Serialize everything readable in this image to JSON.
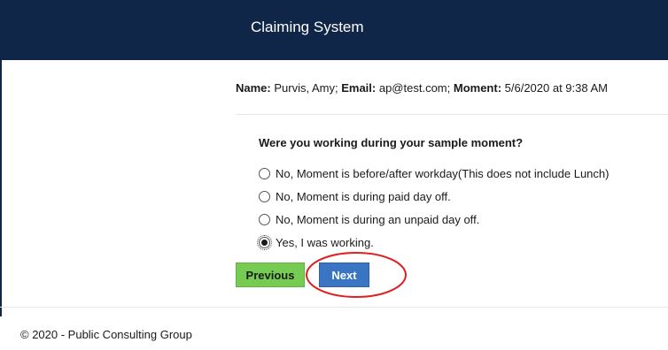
{
  "header": {
    "title": "Claiming System"
  },
  "info": {
    "name_label": "Name:",
    "name_value": " Purvis, Amy; ",
    "email_label": "Email:",
    "email_value": " ap@test.com; ",
    "moment_label": "Moment:",
    "moment_value": " 5/6/2020 at 9:38 AM"
  },
  "question": "Were you working during your sample moment?",
  "options": [
    {
      "label": "No, Moment is before/after workday(This does not include Lunch)",
      "selected": false
    },
    {
      "label": "No, Moment is during paid day off.",
      "selected": false
    },
    {
      "label": "No, Moment is during an unpaid day off.",
      "selected": false
    },
    {
      "label": "Yes, I was working.",
      "selected": true
    }
  ],
  "buttons": {
    "previous": "Previous",
    "next": "Next"
  },
  "colors": {
    "header_bg": "#0f2648",
    "previous_bg": "#76cc52",
    "next_bg": "#3a75c4",
    "annotation": "#e02020"
  },
  "footer": {
    "copyright": "© 2020 - Public Consulting Group"
  }
}
